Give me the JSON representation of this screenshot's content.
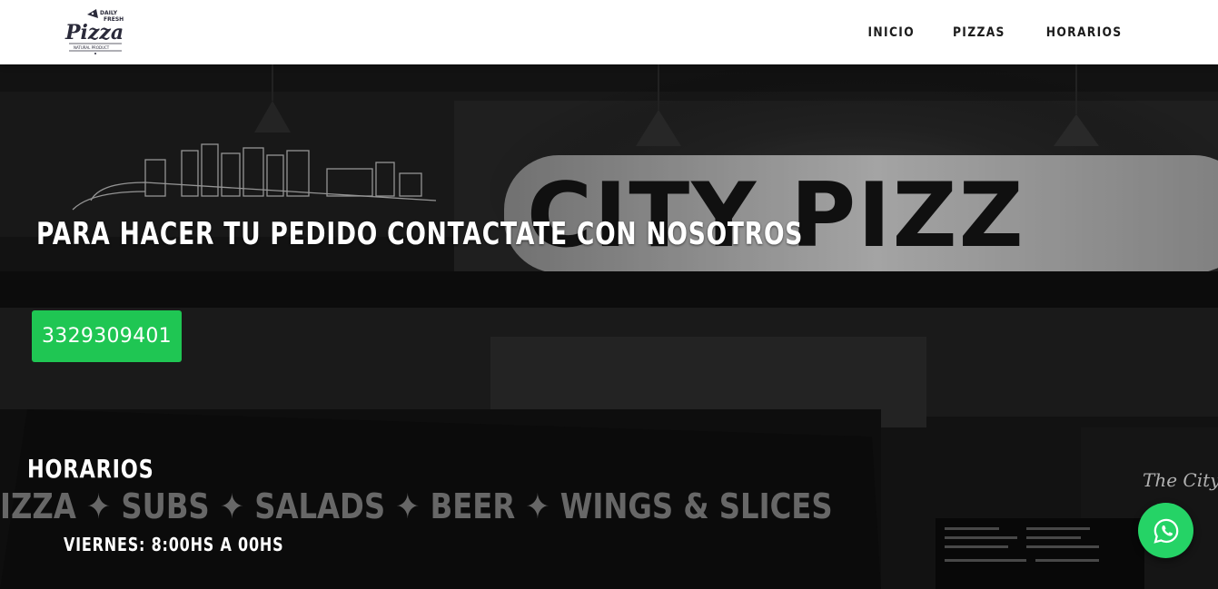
{
  "brand": {
    "logo_line1": "DAILY",
    "logo_line2": "FRESH",
    "logo_name": "Pizza",
    "logo_tagline": "NATURAL PRODUCT"
  },
  "nav": {
    "items": [
      {
        "label": "INICIO"
      },
      {
        "label": "PIZZAS"
      },
      {
        "label": "HORARIOS"
      }
    ]
  },
  "hero": {
    "headline": "PARA HACER TU PEDIDO CONTACTATE CON NOSOTROS",
    "phone": "3329309401",
    "sign_text": "CITY PIZZ",
    "menu_strip_text": "IZZA ✦ SUBS ✦ SALADS ✦ BEER ✦ WINGS & SLICES",
    "script_text": "The City's"
  },
  "hours": {
    "title": "HORARIOS",
    "items": [
      {
        "text": "VIERNES: 8:00HS A 00HS"
      }
    ]
  },
  "colors": {
    "accent_green": "#1fc653",
    "whatsapp_green": "#25d366",
    "header_bg": "#ffffff",
    "nav_text": "#1b1b1b"
  },
  "icons": {
    "whatsapp": "whatsapp-icon"
  }
}
